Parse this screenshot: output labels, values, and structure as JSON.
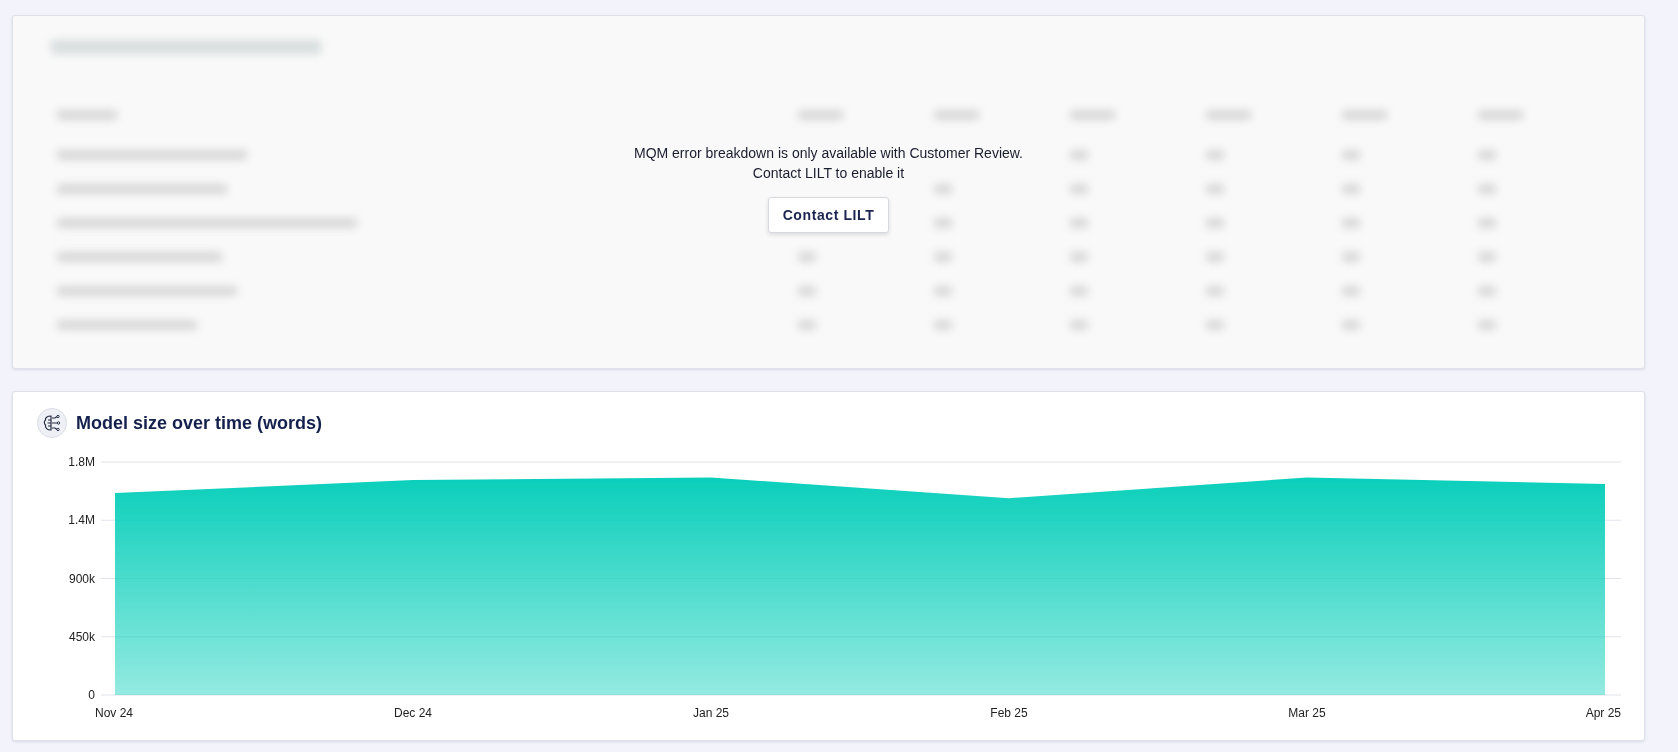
{
  "locked_panel": {
    "message_lines": [
      "MQM error breakdown is only available with Customer Review.",
      "Contact LILT to enable it"
    ],
    "button": "Contact LILT"
  },
  "model_panel": {
    "title": "Model size over time (words)",
    "chart_data": {
      "type": "area",
      "categories": [
        "Nov 24",
        "Dec 24",
        "Jan 25",
        "Feb 25",
        "Mar 25",
        "Apr 25"
      ],
      "grid": true,
      "series": [
        {
          "color": "#00cdb8",
          "values": [
            1560000,
            1660000,
            1680000,
            1520000,
            1680000,
            1630000
          ]
        }
      ],
      "ylim": [
        0,
        1800000
      ],
      "yticks": [
        {
          "value": 0,
          "label": "0"
        },
        {
          "value": 450000,
          "label": "450k"
        },
        {
          "value": 900000,
          "label": "900k"
        },
        {
          "value": 1350000,
          "label": "1.4M"
        },
        {
          "value": 1800000,
          "label": "1.8M"
        }
      ]
    }
  }
}
